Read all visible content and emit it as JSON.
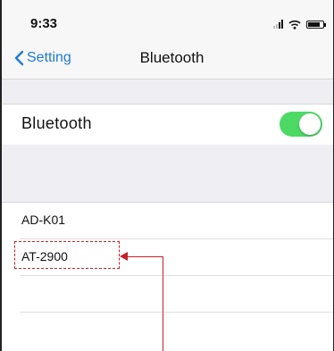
{
  "status_bar": {
    "time": "9:33"
  },
  "nav": {
    "back_label": "Setting",
    "title": "Bluetooth"
  },
  "bluetooth": {
    "label": "Bluetooth",
    "enabled": true
  },
  "devices": [
    {
      "label": "AD-K01"
    },
    {
      "label": "AT-2900"
    }
  ],
  "colors": {
    "accent": "#1f7ad6",
    "toggle_on": "#4cd964",
    "callout": "#c4202a"
  },
  "icons": {
    "back": "chevron-left-icon",
    "signal": "cellular-signal-icon",
    "wifi": "wifi-icon",
    "battery": "battery-icon"
  }
}
